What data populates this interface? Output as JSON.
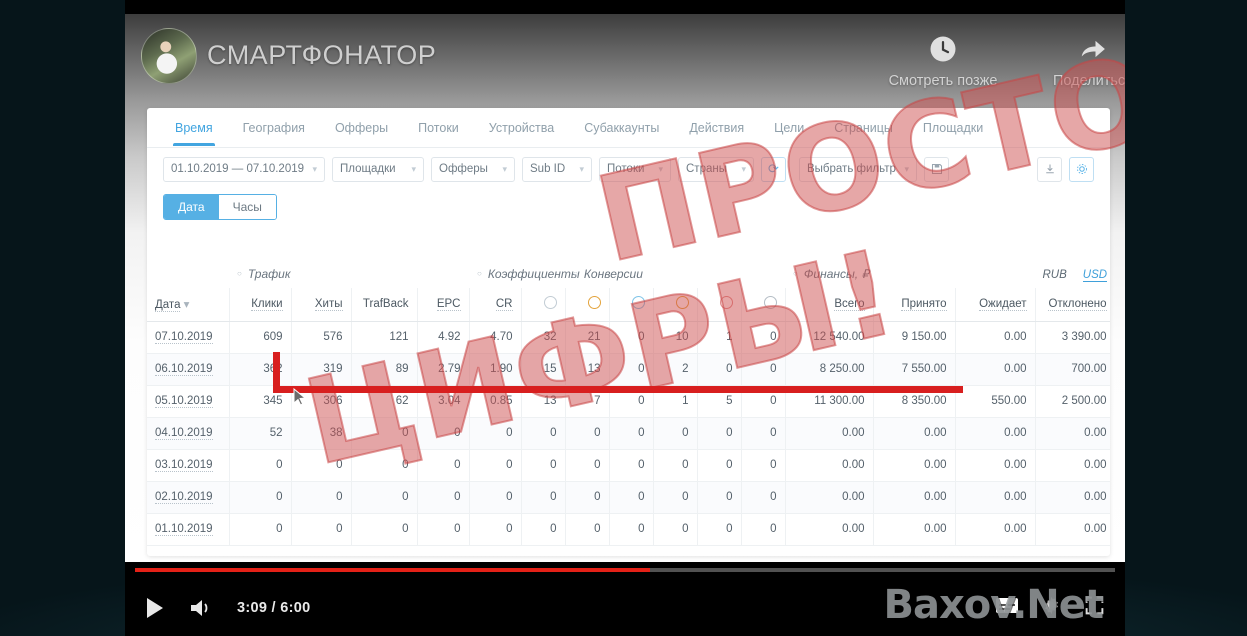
{
  "video": {
    "channel_title": "СМАРТФОНАТОР",
    "watch_later": "Смотреть позже",
    "share": "Поделиться",
    "time_display": "3:09 / 6:00",
    "current_time": "3:09",
    "duration": "6:00",
    "progress_percent": 52.5,
    "watermark": "Baxov.Net",
    "accent_color": "#e52117"
  },
  "stamp": {
    "line1": "ПРОСТО",
    "line2": "ЦИФРЫ!",
    "color": "#ce5050"
  },
  "tabs": [
    {
      "label": "Время",
      "active": true
    },
    {
      "label": "География",
      "active": false
    },
    {
      "label": "Офферы",
      "active": false
    },
    {
      "label": "Потоки",
      "active": false
    },
    {
      "label": "Устройства",
      "active": false
    },
    {
      "label": "Субаккаунты",
      "active": false
    },
    {
      "label": "Действия",
      "active": false
    },
    {
      "label": "Цели",
      "active": false
    },
    {
      "label": "Страницы",
      "active": false
    },
    {
      "label": "Площадки",
      "active": false
    }
  ],
  "filters": {
    "date_range": "01.10.2019 — 07.10.2019",
    "sites": "Площадки",
    "offers": "Офферы",
    "subid": "Sub ID",
    "streams": "Потоки",
    "countries": "Страны",
    "refresh_icon": "refresh-icon",
    "filter_select": "Выбрать фильтр",
    "save_icon": "save-icon",
    "export_icon": "export-icon",
    "settings_icon": "settings-icon"
  },
  "segmented": {
    "date": "Дата",
    "hours": "Часы",
    "active": "Дата"
  },
  "currency": {
    "rub": "RUB",
    "usd": "USD",
    "active": "USD"
  },
  "table": {
    "groups": [
      {
        "label": "Трафик"
      },
      {
        "label": "Коэффициенты"
      },
      {
        "label": "Конверсии"
      },
      {
        "label": "Финансы, ₽"
      }
    ],
    "columns": [
      "Дата",
      "Клики",
      "Хиты",
      "TrafBack",
      "EPC",
      "CR",
      "icon-pending",
      "icon-approved",
      "icon-hold",
      "icon-open",
      "icon-rejected",
      "icon-trash",
      "Всего",
      "Принято",
      "Ожидает",
      "Отклонено"
    ],
    "rows": [
      {
        "date": "07.10.2019",
        "clicks": "609",
        "hits": "576",
        "trafback": "121",
        "epc": "4.92",
        "cr": "4.70",
        "c1": "32",
        "c2": "21",
        "c3": "0",
        "c4": "10",
        "c5": "1",
        "c6": "0",
        "total": "12 540.00",
        "accepted": "9 150.00",
        "pending": "0.00",
        "rejected": "3 390.00"
      },
      {
        "date": "06.10.2019",
        "clicks": "362",
        "hits": "319",
        "trafback": "89",
        "epc": "2.79",
        "cr": "1.90",
        "c1": "15",
        "c2": "13",
        "c3": "0",
        "c4": "2",
        "c5": "0",
        "c6": "0",
        "total": "8 250.00",
        "accepted": "7 550.00",
        "pending": "0.00",
        "rejected": "700.00"
      },
      {
        "date": "05.10.2019",
        "clicks": "345",
        "hits": "306",
        "trafback": "62",
        "epc": "3.04",
        "cr": "0.85",
        "c1": "13",
        "c2": "7",
        "c3": "0",
        "c4": "1",
        "c5": "5",
        "c6": "0",
        "total": "11 300.00",
        "accepted": "8 350.00",
        "pending": "550.00",
        "rejected": "2 500.00"
      },
      {
        "date": "04.10.2019",
        "clicks": "52",
        "hits": "38",
        "trafback": "0",
        "epc": "0",
        "cr": "0",
        "c1": "0",
        "c2": "0",
        "c3": "0",
        "c4": "0",
        "c5": "0",
        "c6": "0",
        "total": "0.00",
        "accepted": "0.00",
        "pending": "0.00",
        "rejected": "0.00"
      },
      {
        "date": "03.10.2019",
        "clicks": "0",
        "hits": "0",
        "trafback": "0",
        "epc": "0",
        "cr": "0",
        "c1": "0",
        "c2": "0",
        "c3": "0",
        "c4": "0",
        "c5": "0",
        "c6": "0",
        "total": "0.00",
        "accepted": "0.00",
        "pending": "0.00",
        "rejected": "0.00"
      },
      {
        "date": "02.10.2019",
        "clicks": "0",
        "hits": "0",
        "trafback": "0",
        "epc": "0",
        "cr": "0",
        "c1": "0",
        "c2": "0",
        "c3": "0",
        "c4": "0",
        "c5": "0",
        "c6": "0",
        "total": "0.00",
        "accepted": "0.00",
        "pending": "0.00",
        "rejected": "0.00"
      },
      {
        "date": "01.10.2019",
        "clicks": "0",
        "hits": "0",
        "trafback": "0",
        "epc": "0",
        "cr": "0",
        "c1": "0",
        "c2": "0",
        "c3": "0",
        "c4": "0",
        "c5": "0",
        "c6": "0",
        "total": "0.00",
        "accepted": "0.00",
        "pending": "0.00",
        "rejected": "0.00"
      }
    ]
  }
}
